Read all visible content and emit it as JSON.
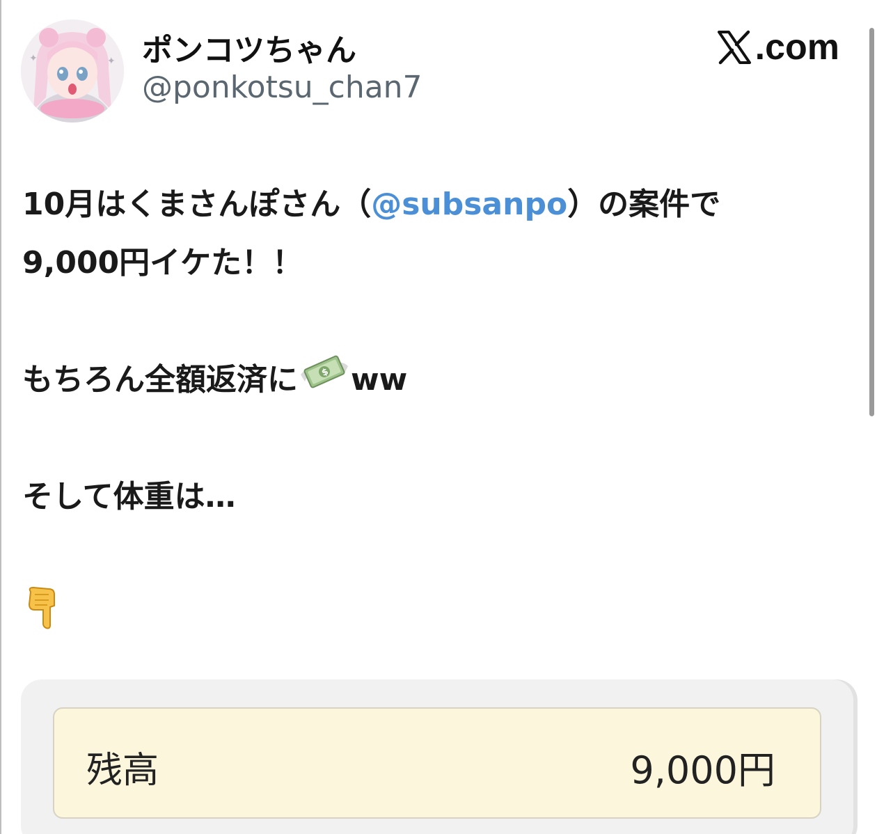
{
  "author": {
    "display_name": "ポンコツちゃん",
    "handle": "@ponkotsu_chan7"
  },
  "brand": {
    "text": ".com",
    "icon": "x-logo-icon"
  },
  "tweet": {
    "line1_prefix": "10月はくまさんぽさん（",
    "line1_mention": "@subsanpo",
    "line1_suffix": "）の案件で",
    "line2": "9,000円イケた！！",
    "line3_text": "もちろん全額返済に",
    "line3_emoji": "money-with-wings-icon",
    "line3_suffix": "ww",
    "line4": "そして体重は…",
    "line5_emoji": "backhand-index-pointing-down-icon"
  },
  "balance": {
    "label": "残高",
    "value": "9,000円"
  },
  "colors": {
    "mention": "#4b8fd6",
    "handle": "#5b6770",
    "balance_bg": "#fbf6dc"
  }
}
